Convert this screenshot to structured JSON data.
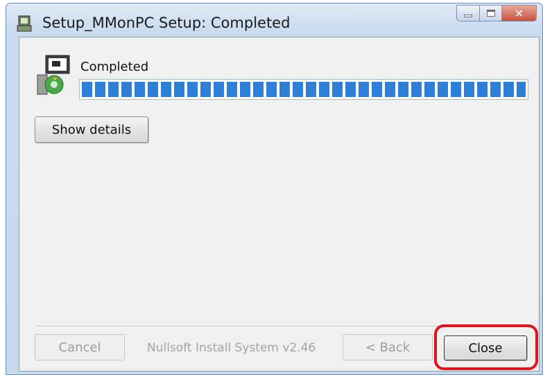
{
  "window": {
    "title": "Setup_MMonPC Setup: Completed",
    "caption_buttons": [
      "minimize-icon",
      "maximize-icon",
      "close-icon"
    ]
  },
  "status": {
    "text": "Completed",
    "progress_fraction": 1.0
  },
  "buttons": {
    "show_details": "Show details",
    "cancel": "Cancel",
    "back": "< Back",
    "close": "Close"
  },
  "branding": "Nullsoft Install System v2.46",
  "colors": {
    "progress": "#2d7fd8",
    "highlight": "#e0141e"
  },
  "annotation": {
    "highlighted_element": "close-button"
  }
}
